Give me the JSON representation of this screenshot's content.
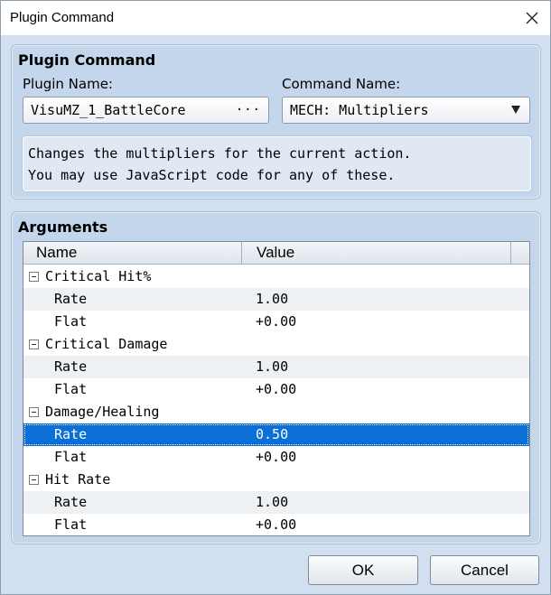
{
  "window": {
    "title": "Plugin Command"
  },
  "plugin_panel": {
    "title": "Plugin Command",
    "plugin_name_label": "Plugin Name:",
    "plugin_name_value": "VisuMZ_1_BattleCore",
    "plugin_name_dots": "···",
    "command_name_label": "Command Name:",
    "command_name_value": "MECH: Multipliers",
    "description": [
      "Changes the multipliers for the current action.",
      "You may use JavaScript code for any of these."
    ]
  },
  "arguments": {
    "title": "Arguments",
    "columns": [
      "Name",
      "Value"
    ],
    "rows": [
      {
        "name": "Critical Hit%",
        "value": "",
        "group": true
      },
      {
        "name": "Rate",
        "value": "1.00"
      },
      {
        "name": "Flat",
        "value": "+0.00"
      },
      {
        "name": "Critical Damage",
        "value": "",
        "group": true
      },
      {
        "name": "Rate",
        "value": "1.00"
      },
      {
        "name": "Flat",
        "value": "+0.00"
      },
      {
        "name": "Damage/Healing",
        "value": "",
        "group": true
      },
      {
        "name": "Rate",
        "value": "0.50",
        "selected": true
      },
      {
        "name": "Flat",
        "value": "+0.00"
      },
      {
        "name": "Hit Rate",
        "value": "",
        "group": true
      },
      {
        "name": "Rate",
        "value": "1.00"
      },
      {
        "name": "Flat",
        "value": "+0.00"
      }
    ]
  },
  "buttons": {
    "ok": "OK",
    "cancel": "Cancel"
  },
  "icons": {
    "close": "close-icon",
    "dropdown": "chevron-down-icon",
    "collapse": "minus-box-icon"
  },
  "colors": {
    "selection": "#0b6fd5",
    "panel": "#c3d6ec",
    "window": "#d1dff0"
  }
}
